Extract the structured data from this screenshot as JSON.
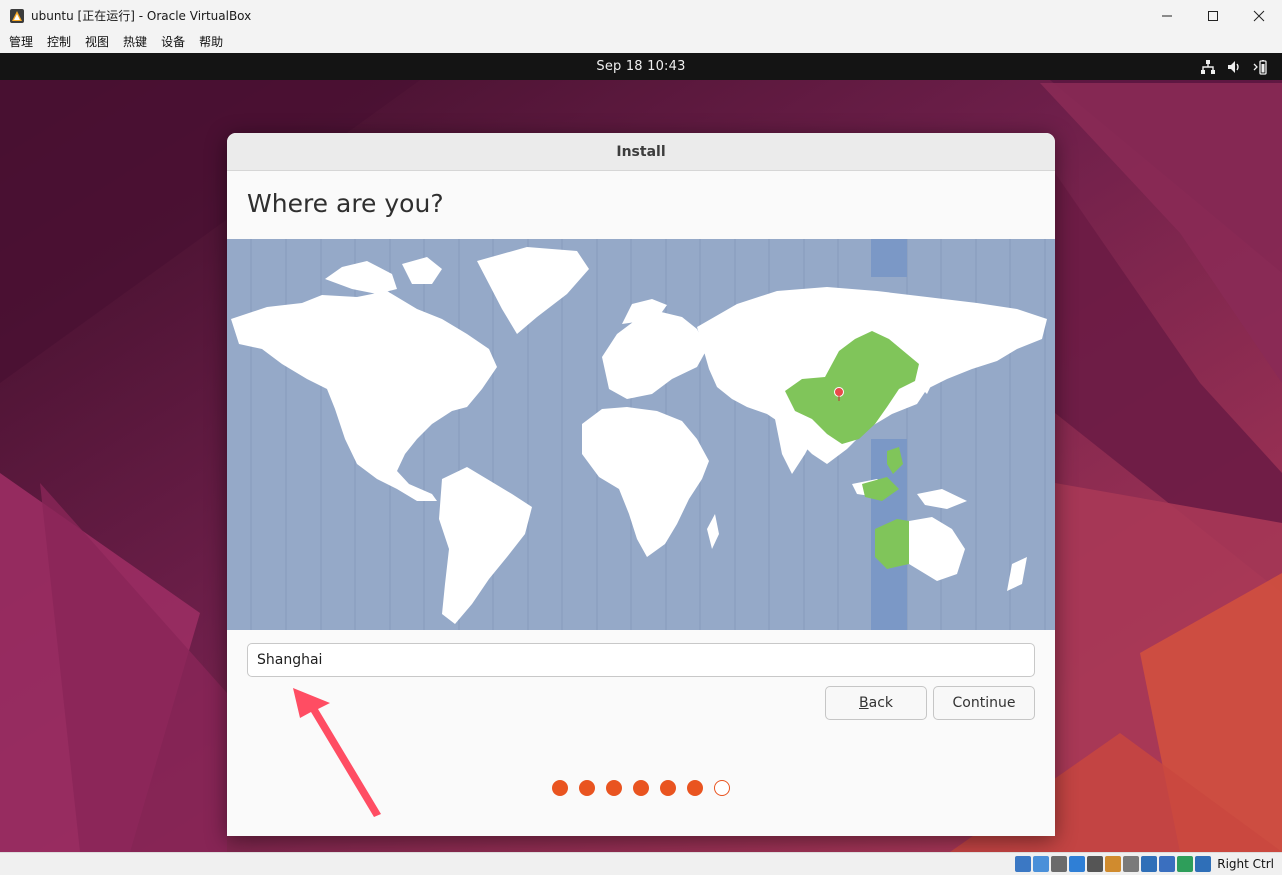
{
  "window": {
    "title": "ubuntu [正在运行] - Oracle VirtualBox",
    "controls": [
      "minimize-icon",
      "maximize-icon",
      "close-icon"
    ]
  },
  "menubar": {
    "items": [
      "管理",
      "控制",
      "视图",
      "热键",
      "设备",
      "帮助"
    ]
  },
  "guest": {
    "topbar": {
      "clock": "Sep 18  10:43",
      "tray_icons": [
        "network-icon",
        "volume-icon",
        "battery-icon"
      ]
    }
  },
  "installer": {
    "title": "Install",
    "heading": "Where are you?",
    "timezone_value": "Shanghai",
    "back_label_underlined": "B",
    "back_label_rest": "ack",
    "continue_label": "Continue",
    "progress": {
      "total_steps": 7,
      "completed_steps": 6
    }
  },
  "statusbar": {
    "icons": [
      "hard-disk-icon",
      "optical-drive-icon",
      "audio-icon",
      "network-adapter-icon",
      "usb-icon",
      "shared-folder-icon",
      "display-icon",
      "screen-capture-icon",
      "virtualization-icon",
      "globe-icon",
      "mouse-integration-icon"
    ],
    "host_key": "Right Ctrl"
  },
  "colors": {
    "accent": "#e95420",
    "map_ocean": "#95a9c8",
    "map_highlight_band": "#7b98c6",
    "selected_region": "#80c55a"
  }
}
